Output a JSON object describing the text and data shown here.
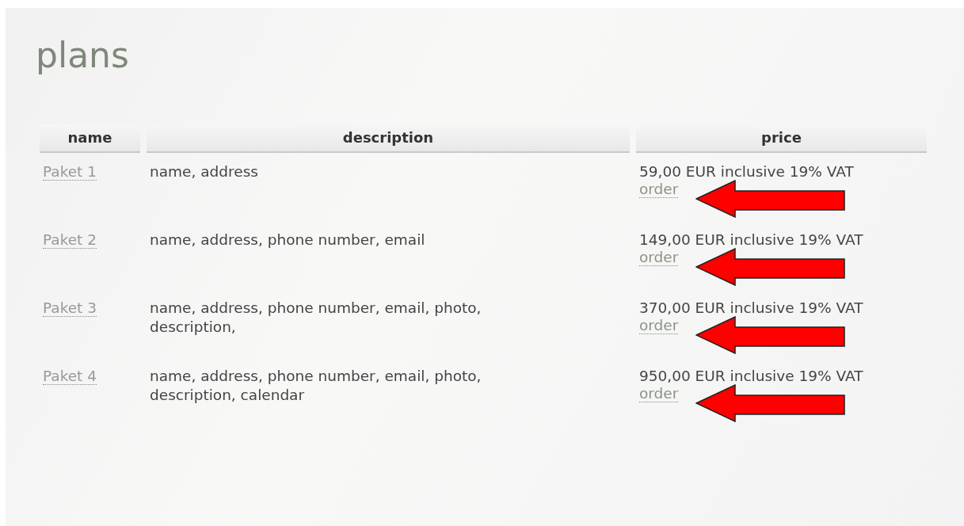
{
  "title": "plans",
  "table": {
    "columns": [
      "name",
      "description",
      "price"
    ],
    "rows": [
      {
        "name": "Paket 1",
        "description": "name, address",
        "price": "59,00 EUR inclusive 19% VAT",
        "action": "order"
      },
      {
        "name": "Paket 2",
        "description": "name, address, phone number, email",
        "price": "149,00 EUR inclusive 19% VAT",
        "action": "order"
      },
      {
        "name": "Paket 3",
        "description": "name, address, phone number, email, photo, description,",
        "price": "370,00 EUR inclusive 19% VAT",
        "action": "order"
      },
      {
        "name": "Paket 4",
        "description": "name, address, phone number, email, photo, description, calendar",
        "price": "950,00 EUR inclusive 19% VAT",
        "action": "order"
      }
    ]
  }
}
